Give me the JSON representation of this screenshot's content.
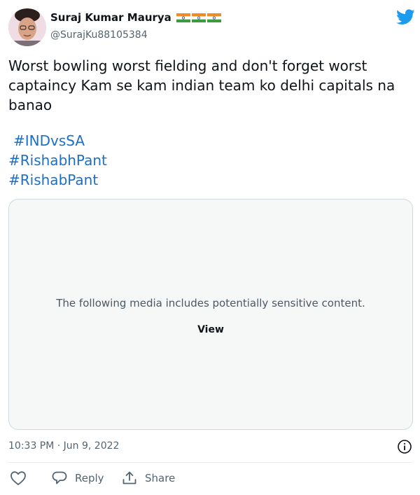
{
  "user": {
    "display_name": "Suraj Kumar Maurya",
    "handle": "@SurajKu88105384",
    "badges": [
      "india-flag-emoji",
      "india-flag-emoji",
      "india-flag-emoji"
    ]
  },
  "tweet": {
    "text": "Worst bowling worst fielding and don't forget worst captaincy Kam se kam indian team ko delhi capitals na banao",
    "hashtags": [
      "#INDvsSA",
      "#RishabhPant",
      "#RishabPant"
    ]
  },
  "media": {
    "notice": "The following media includes potentially sensitive content.",
    "view_label": "View"
  },
  "meta": {
    "timestamp": "10:33 PM · Jun 9, 2022"
  },
  "actions": {
    "reply_label": "Reply",
    "share_label": "Share"
  },
  "colors": {
    "link": "#1b6fc8",
    "twitter_blue": "#1d9bf0",
    "secondary_text": "#536471",
    "media_bg": "#f6f7f7"
  },
  "icons": [
    "twitter-bird-icon",
    "heart-icon",
    "comment-icon",
    "share-icon",
    "info-icon"
  ]
}
